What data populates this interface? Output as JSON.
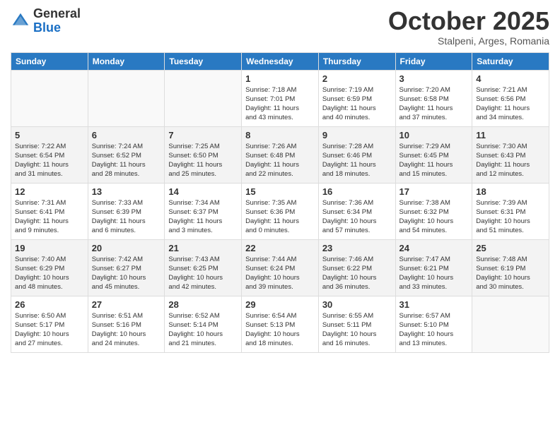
{
  "logo": {
    "general": "General",
    "blue": "Blue"
  },
  "header": {
    "month": "October 2025",
    "location": "Stalpeni, Arges, Romania"
  },
  "weekdays": [
    "Sunday",
    "Monday",
    "Tuesday",
    "Wednesday",
    "Thursday",
    "Friday",
    "Saturday"
  ],
  "weeks": [
    [
      {
        "day": "",
        "info": ""
      },
      {
        "day": "",
        "info": ""
      },
      {
        "day": "",
        "info": ""
      },
      {
        "day": "1",
        "info": "Sunrise: 7:18 AM\nSunset: 7:01 PM\nDaylight: 11 hours\nand 43 minutes."
      },
      {
        "day": "2",
        "info": "Sunrise: 7:19 AM\nSunset: 6:59 PM\nDaylight: 11 hours\nand 40 minutes."
      },
      {
        "day": "3",
        "info": "Sunrise: 7:20 AM\nSunset: 6:58 PM\nDaylight: 11 hours\nand 37 minutes."
      },
      {
        "day": "4",
        "info": "Sunrise: 7:21 AM\nSunset: 6:56 PM\nDaylight: 11 hours\nand 34 minutes."
      }
    ],
    [
      {
        "day": "5",
        "info": "Sunrise: 7:22 AM\nSunset: 6:54 PM\nDaylight: 11 hours\nand 31 minutes."
      },
      {
        "day": "6",
        "info": "Sunrise: 7:24 AM\nSunset: 6:52 PM\nDaylight: 11 hours\nand 28 minutes."
      },
      {
        "day": "7",
        "info": "Sunrise: 7:25 AM\nSunset: 6:50 PM\nDaylight: 11 hours\nand 25 minutes."
      },
      {
        "day": "8",
        "info": "Sunrise: 7:26 AM\nSunset: 6:48 PM\nDaylight: 11 hours\nand 22 minutes."
      },
      {
        "day": "9",
        "info": "Sunrise: 7:28 AM\nSunset: 6:46 PM\nDaylight: 11 hours\nand 18 minutes."
      },
      {
        "day": "10",
        "info": "Sunrise: 7:29 AM\nSunset: 6:45 PM\nDaylight: 11 hours\nand 15 minutes."
      },
      {
        "day": "11",
        "info": "Sunrise: 7:30 AM\nSunset: 6:43 PM\nDaylight: 11 hours\nand 12 minutes."
      }
    ],
    [
      {
        "day": "12",
        "info": "Sunrise: 7:31 AM\nSunset: 6:41 PM\nDaylight: 11 hours\nand 9 minutes."
      },
      {
        "day": "13",
        "info": "Sunrise: 7:33 AM\nSunset: 6:39 PM\nDaylight: 11 hours\nand 6 minutes."
      },
      {
        "day": "14",
        "info": "Sunrise: 7:34 AM\nSunset: 6:37 PM\nDaylight: 11 hours\nand 3 minutes."
      },
      {
        "day": "15",
        "info": "Sunrise: 7:35 AM\nSunset: 6:36 PM\nDaylight: 11 hours\nand 0 minutes."
      },
      {
        "day": "16",
        "info": "Sunrise: 7:36 AM\nSunset: 6:34 PM\nDaylight: 10 hours\nand 57 minutes."
      },
      {
        "day": "17",
        "info": "Sunrise: 7:38 AM\nSunset: 6:32 PM\nDaylight: 10 hours\nand 54 minutes."
      },
      {
        "day": "18",
        "info": "Sunrise: 7:39 AM\nSunset: 6:31 PM\nDaylight: 10 hours\nand 51 minutes."
      }
    ],
    [
      {
        "day": "19",
        "info": "Sunrise: 7:40 AM\nSunset: 6:29 PM\nDaylight: 10 hours\nand 48 minutes."
      },
      {
        "day": "20",
        "info": "Sunrise: 7:42 AM\nSunset: 6:27 PM\nDaylight: 10 hours\nand 45 minutes."
      },
      {
        "day": "21",
        "info": "Sunrise: 7:43 AM\nSunset: 6:25 PM\nDaylight: 10 hours\nand 42 minutes."
      },
      {
        "day": "22",
        "info": "Sunrise: 7:44 AM\nSunset: 6:24 PM\nDaylight: 10 hours\nand 39 minutes."
      },
      {
        "day": "23",
        "info": "Sunrise: 7:46 AM\nSunset: 6:22 PM\nDaylight: 10 hours\nand 36 minutes."
      },
      {
        "day": "24",
        "info": "Sunrise: 7:47 AM\nSunset: 6:21 PM\nDaylight: 10 hours\nand 33 minutes."
      },
      {
        "day": "25",
        "info": "Sunrise: 7:48 AM\nSunset: 6:19 PM\nDaylight: 10 hours\nand 30 minutes."
      }
    ],
    [
      {
        "day": "26",
        "info": "Sunrise: 6:50 AM\nSunset: 5:17 PM\nDaylight: 10 hours\nand 27 minutes."
      },
      {
        "day": "27",
        "info": "Sunrise: 6:51 AM\nSunset: 5:16 PM\nDaylight: 10 hours\nand 24 minutes."
      },
      {
        "day": "28",
        "info": "Sunrise: 6:52 AM\nSunset: 5:14 PM\nDaylight: 10 hours\nand 21 minutes."
      },
      {
        "day": "29",
        "info": "Sunrise: 6:54 AM\nSunset: 5:13 PM\nDaylight: 10 hours\nand 18 minutes."
      },
      {
        "day": "30",
        "info": "Sunrise: 6:55 AM\nSunset: 5:11 PM\nDaylight: 10 hours\nand 16 minutes."
      },
      {
        "day": "31",
        "info": "Sunrise: 6:57 AM\nSunset: 5:10 PM\nDaylight: 10 hours\nand 13 minutes."
      },
      {
        "day": "",
        "info": ""
      }
    ]
  ]
}
